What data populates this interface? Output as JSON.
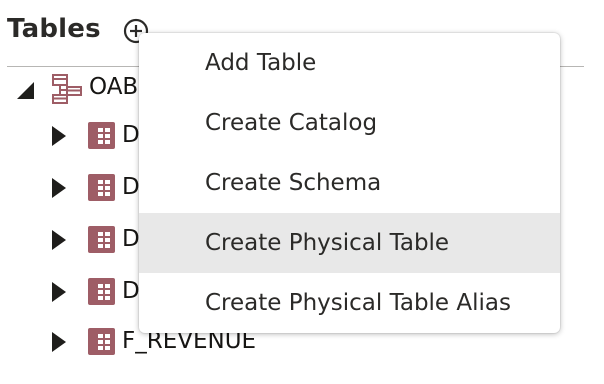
{
  "panel": {
    "title": "Tables",
    "add_icon": "plus-circle-icon"
  },
  "tree": {
    "root": {
      "label": "OAB",
      "icon": "database-schema-icon",
      "state": "expanded"
    },
    "children": [
      {
        "label": "D",
        "icon": "table-icon"
      },
      {
        "label": "D",
        "icon": "table-icon"
      },
      {
        "label": "D",
        "icon": "table-icon"
      },
      {
        "label": "D",
        "icon": "table-icon"
      },
      {
        "label": "F_REVENUE",
        "icon": "table-icon"
      }
    ]
  },
  "menu": {
    "items": [
      {
        "label": "Add Table"
      },
      {
        "label": "Create Catalog"
      },
      {
        "label": "Create Schema"
      },
      {
        "label": "Create Physical Table",
        "highlighted": true
      },
      {
        "label": "Create Physical Table Alias"
      }
    ]
  },
  "colors": {
    "table_icon": "#9e5d66",
    "schema_icon": "#9e5d66",
    "menu_highlight": "#e8e8e8",
    "divider": "#b7b6b4"
  }
}
